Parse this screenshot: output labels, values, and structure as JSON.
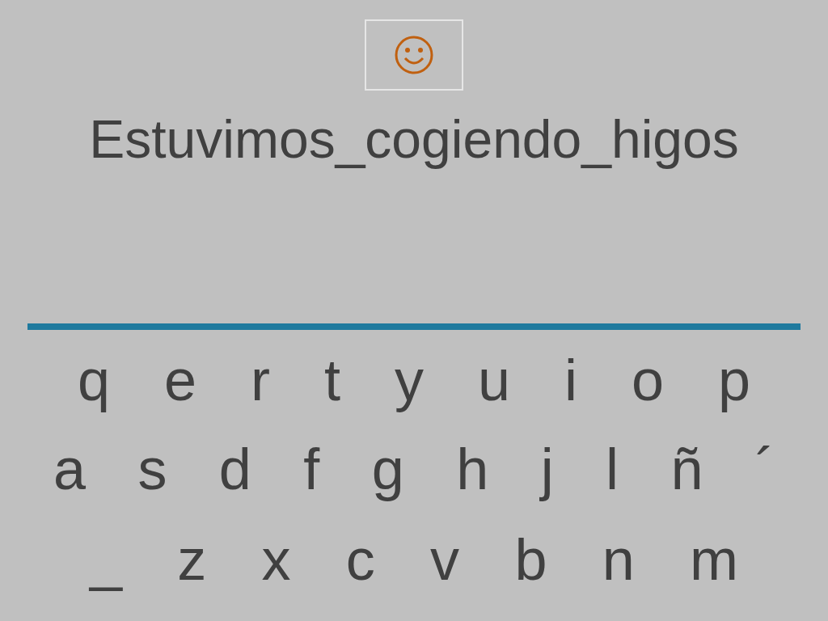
{
  "sentence": "Estuvimos_cogiendo_higos",
  "keyboard": {
    "rows": [
      {
        "keys": [
          "q",
          "e",
          "r",
          "t",
          "y",
          "u",
          "i",
          "o",
          "p"
        ]
      },
      {
        "keys": [
          "a",
          "s",
          "d",
          "f",
          "g",
          "h",
          "j",
          "l",
          "ñ",
          "´"
        ]
      },
      {
        "keys": [
          "_",
          "z",
          "x",
          "c",
          "v",
          "b",
          "n",
          "m"
        ]
      }
    ]
  }
}
